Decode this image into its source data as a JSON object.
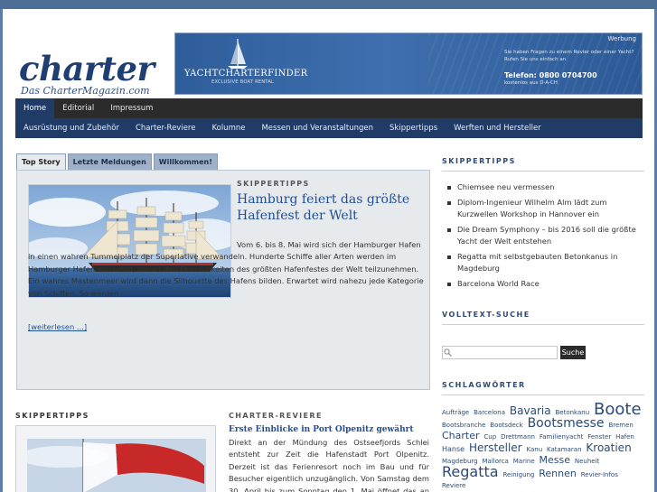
{
  "header": {
    "logo_title": "charter",
    "logo_subtitle": "Das CharterMagazin.com"
  },
  "ad": {
    "label": "Werbung",
    "brand": "YACHTCHARTERFINDER",
    "tagline": "EXCLUSIVE BOAT RENTAL",
    "question": "Sie haben Fragen zu einem Revier oder einer Yacht? Rufen Sie uns einfach an",
    "phone": "Telefon: 0800 0704700",
    "free": "kostenlos aus D-A-CH"
  },
  "nav_main": [
    "Home",
    "Editorial",
    "Impressum"
  ],
  "nav_categories": [
    "Ausrüstung und Zubehör",
    "Charter-Reviere",
    "Kolumne",
    "Messen und Veranstaltungen",
    "Skippertipps",
    "Werften und Hersteller"
  ],
  "tabs": [
    "Top Story",
    "Letzte Meldungen",
    "Willkommen!"
  ],
  "feature": {
    "category": "SKIPPERTIPPS",
    "title": "Hamburg feiert das größte Hafenfest der Welt",
    "text": "Vom 6. bis 8. Mai wird sich der Hamburger Hafen in einen wahren Tummelplatz der Superlative verwandeln. Hunderte Schiffe aller Arten werden im Hamburger Hafen einlaufen, um an den Feierlichkeiten des größten Hafenfestes der Welt teilzunehmen. Ein wahres Mastenmeer wird dann die Silhouette des Hafens bilden. Erwartet wird nahezu jede Kategorie von Schiffen. So werden",
    "more": "[weiterlesen ...]"
  },
  "block_left": {
    "heading": "SKIPPERTIPPS"
  },
  "block_mid": {
    "heading": "CHARTER-REVIERE",
    "title": "Erste Einblicke in Port Olpenitz gewährt",
    "text": "Direkt an der Mündung des Ostseefjords Schlei entsteht zur Zeit die Hafenstadt Port Olpenitz. Derzeit ist das Ferienresort noch im Bau und für Besucher eigentlich unzugänglich. Von Samstag dem 30. April bis zum Sonntag den 1. Mai öffnet das an der"
  },
  "sidebar": {
    "skippertipps_heading": "SKIPPERTIPPS",
    "skippertipps": [
      "Chiemsee neu vermessen",
      "Diplom-Ingenieur Wilhelm Alm lädt zum Kurzwellen Workshop in Hannover ein",
      "Die Dream Symphony – bis 2016 soll die größte Yacht der Welt entstehen",
      "Regatta mit selbstgebauten Betonkanus in Magdeburg",
      "Barcelona World Race"
    ],
    "search_heading": "VOLLTEXT-SUCHE",
    "search_button": "Suche",
    "search_value": "",
    "tags_heading": "SCHLAGWÖRTER",
    "tags": [
      {
        "t": "Aufträge",
        "s": 7
      },
      {
        "t": "Barcelona",
        "s": 7
      },
      {
        "t": "Bavaria",
        "s": 12
      },
      {
        "t": "Betonkanu",
        "s": 7
      },
      {
        "t": "Boote",
        "s": 18
      },
      {
        "t": "Bootsbranche",
        "s": 7
      },
      {
        "t": "Bootsdeck",
        "s": 7
      },
      {
        "t": "Bootsmesse",
        "s": 14
      },
      {
        "t": "Bremen",
        "s": 7
      },
      {
        "t": "Charter",
        "s": 11
      },
      {
        "t": "Cup",
        "s": 7
      },
      {
        "t": "Drettmann",
        "s": 7
      },
      {
        "t": "Familienyacht",
        "s": 7
      },
      {
        "t": "Fenster",
        "s": 7
      },
      {
        "t": "Hafen",
        "s": 7
      },
      {
        "t": "Hanse",
        "s": 8
      },
      {
        "t": "Hersteller",
        "s": 12
      },
      {
        "t": "Kanu",
        "s": 7
      },
      {
        "t": "Katamaran",
        "s": 7
      },
      {
        "t": "Kroatien",
        "s": 12
      },
      {
        "t": "Magdeburg",
        "s": 7
      },
      {
        "t": "Mallorca",
        "s": 7
      },
      {
        "t": "Marine",
        "s": 7
      },
      {
        "t": "Messe",
        "s": 11
      },
      {
        "t": "Neuheit",
        "s": 7
      },
      {
        "t": "Regatta",
        "s": 16
      },
      {
        "t": "Reinigung",
        "s": 7
      },
      {
        "t": "Rennen",
        "s": 11
      },
      {
        "t": "Revier-Infos",
        "s": 7
      },
      {
        "t": "Reviere",
        "s": 7
      }
    ]
  }
}
